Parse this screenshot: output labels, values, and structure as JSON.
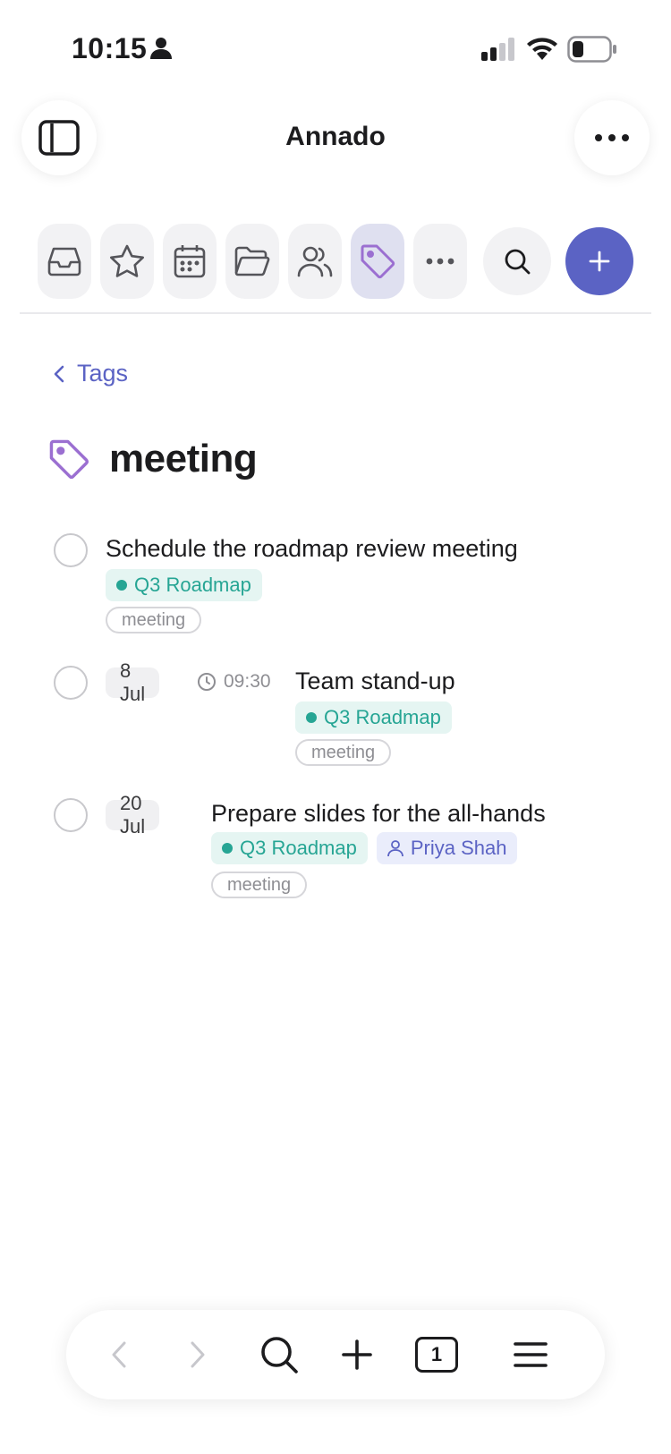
{
  "status_bar": {
    "time": "10:15"
  },
  "header": {
    "app_title": "Annado"
  },
  "toolbar": {
    "items": [
      {
        "id": "inbox",
        "icon": "inbox-icon"
      },
      {
        "id": "favorites",
        "icon": "star-icon"
      },
      {
        "id": "calendar",
        "icon": "calendar-icon"
      },
      {
        "id": "projects",
        "icon": "folder-icon"
      },
      {
        "id": "people",
        "icon": "people-icon"
      },
      {
        "id": "tags",
        "icon": "tag-icon",
        "active": true
      },
      {
        "id": "more",
        "icon": "ellipsis-icon"
      }
    ]
  },
  "breadcrumb": {
    "back_label": "Tags"
  },
  "page": {
    "title": "meeting"
  },
  "tasks": [
    {
      "title": "Schedule the roadmap review meeting",
      "project": "Q3 Roadmap",
      "tag": "meeting"
    },
    {
      "date": "8 Jul",
      "time": "09:30",
      "title": "Team stand-up",
      "project": "Q3 Roadmap",
      "tag": "meeting"
    },
    {
      "date": "20 Jul",
      "title": "Prepare slides for the all-hands",
      "project": "Q3 Roadmap",
      "person": "Priya Shah",
      "tag": "meeting"
    }
  ],
  "browser_bar": {
    "tab_count": "1"
  },
  "colors": {
    "accent": "#5b63c4",
    "tag_purple": "#9b6fd1",
    "project_green": "#26a594",
    "active_tool_bg": "#dfe0f0"
  }
}
